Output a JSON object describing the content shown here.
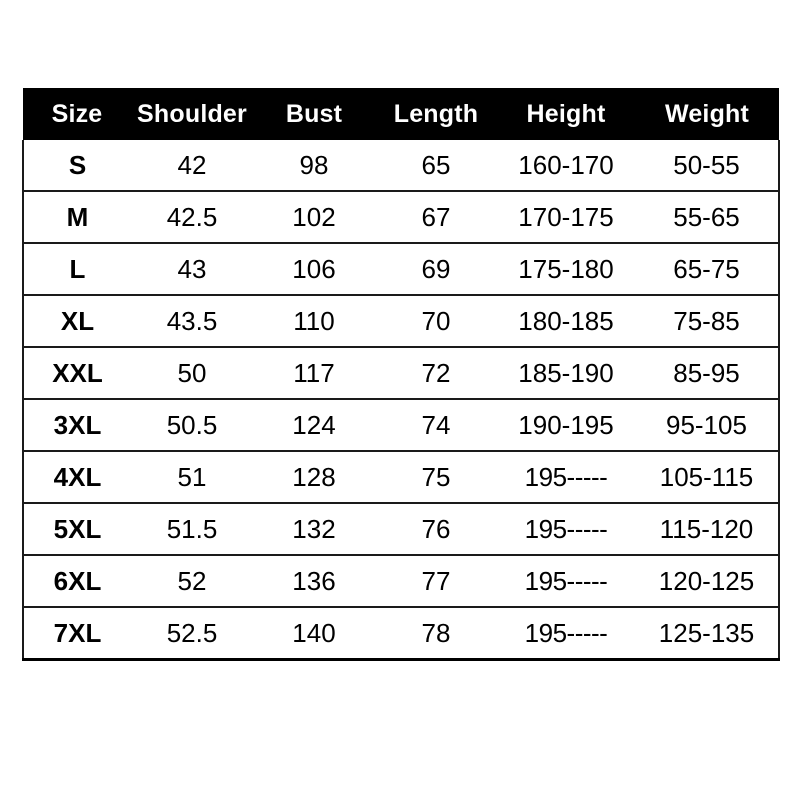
{
  "table": {
    "columns": [
      "Size",
      "Shoulder",
      "Bust",
      "Length",
      "Height",
      "Weight"
    ],
    "rows": [
      {
        "size": "S",
        "shoulder": "42",
        "bust": "98",
        "length": "65",
        "height": "160-170",
        "weight": "50-55"
      },
      {
        "size": "M",
        "shoulder": "42.5",
        "bust": "102",
        "length": "67",
        "height": "170-175",
        "weight": "55-65"
      },
      {
        "size": "L",
        "shoulder": "43",
        "bust": "106",
        "length": "69",
        "height": "175-180",
        "weight": "65-75"
      },
      {
        "size": "XL",
        "shoulder": "43.5",
        "bust": "110",
        "length": "70",
        "height": "180-185",
        "weight": "75-85"
      },
      {
        "size": "XXL",
        "shoulder": "50",
        "bust": "117",
        "length": "72",
        "height": "185-190",
        "weight": "85-95"
      },
      {
        "size": "3XL",
        "shoulder": "50.5",
        "bust": "124",
        "length": "74",
        "height": "190-195",
        "weight": "95-105"
      },
      {
        "size": "4XL",
        "shoulder": "51",
        "bust": "128",
        "length": "75",
        "height": "195-----",
        "weight": "105-115"
      },
      {
        "size": "5XL",
        "shoulder": "51.5",
        "bust": "132",
        "length": "76",
        "height": "195-----",
        "weight": "115-120"
      },
      {
        "size": "6XL",
        "shoulder": "52",
        "bust": "136",
        "length": "77",
        "height": "195-----",
        "weight": "120-125"
      },
      {
        "size": "7XL",
        "shoulder": "52.5",
        "bust": "140",
        "length": "78",
        "height": "195-----",
        "weight": "125-135"
      }
    ]
  },
  "colors": {
    "header_background": "#000000",
    "header_text": "#ffffff",
    "body_text": "#000000",
    "rule": "#1a1a1a",
    "page_background": "#ffffff"
  }
}
